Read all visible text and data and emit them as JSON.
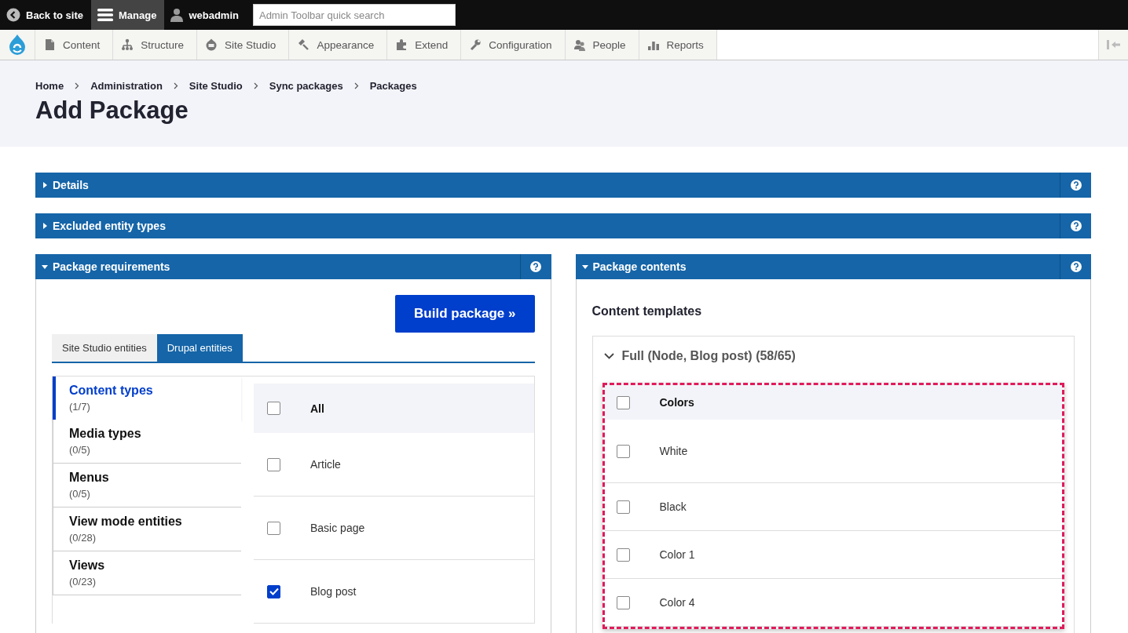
{
  "toolbar": {
    "back": "Back to site",
    "manage": {
      "label": "Manage",
      "selected": true
    },
    "user": "webadmin",
    "search": {
      "placeholder": "Admin Toolbar quick search"
    }
  },
  "nav": {
    "items": [
      {
        "label": "Content"
      },
      {
        "label": "Structure"
      },
      {
        "label": "Site Studio"
      },
      {
        "label": "Appearance"
      },
      {
        "label": "Extend"
      },
      {
        "label": "Configuration"
      },
      {
        "label": "People"
      },
      {
        "label": "Reports"
      }
    ]
  },
  "breadcrumb": [
    "Home",
    "Administration",
    "Site Studio",
    "Sync packages",
    "Packages"
  ],
  "title": "Add Package",
  "sections": [
    {
      "label": "Details",
      "expanded": false
    },
    {
      "label": "Excluded entity types",
      "expanded": false
    }
  ],
  "requirements": {
    "label": "Package requirements",
    "expanded": true,
    "button": "Build package »",
    "tabs": [
      {
        "label": "Site Studio entities",
        "selected": false
      },
      {
        "label": "Drupal entities",
        "selected": true
      }
    ],
    "categories": [
      {
        "label": "Content types",
        "count": "(1/7)",
        "selected": true
      },
      {
        "label": "Media types",
        "count": "(0/5)",
        "selected": false
      },
      {
        "label": "Menus",
        "count": "(0/5)",
        "selected": false
      },
      {
        "label": "View mode entities",
        "count": "(0/28)",
        "selected": false
      },
      {
        "label": "Views",
        "count": "(0/23)",
        "selected": false
      }
    ],
    "items": [
      {
        "kind": "all",
        "label": "All",
        "checked": false
      },
      {
        "kind": "item",
        "label": "Article",
        "checked": false
      },
      {
        "kind": "item",
        "label": "Basic page",
        "checked": false
      },
      {
        "kind": "item",
        "label": "Blog post",
        "checked": true
      }
    ]
  },
  "contents": {
    "label": "Package contents",
    "expanded": true,
    "heading": "Content templates",
    "group": {
      "label": "Full (Node, Blog post) (58/65)",
      "expanded": true,
      "items": [
        {
          "kind": "all",
          "label": "Colors",
          "checked": false
        },
        {
          "kind": "item",
          "label": "White",
          "checked": false
        },
        {
          "kind": "item",
          "label": "Black",
          "checked": false
        },
        {
          "kind": "item",
          "label": "Color 1",
          "checked": false
        },
        {
          "kind": "item",
          "label": "Color 4",
          "checked": false
        }
      ]
    }
  }
}
